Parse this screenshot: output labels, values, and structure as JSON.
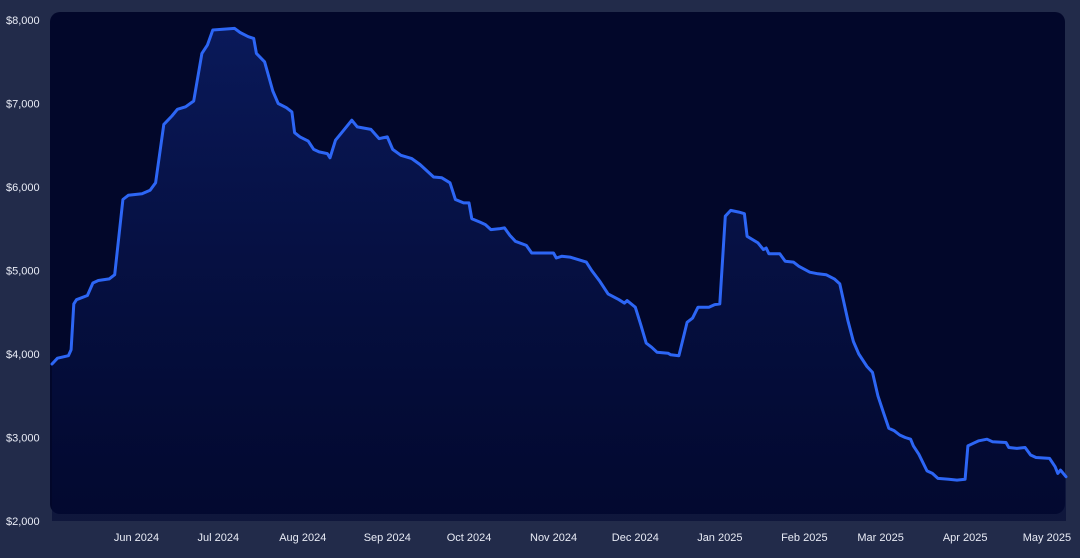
{
  "chart_data": {
    "type": "area",
    "title": "",
    "xlabel": "",
    "ylabel": "",
    "ylim": [
      2000,
      8000
    ],
    "xlim": [
      "2024-05-01",
      "2025-05-08"
    ],
    "grid": false,
    "legend": "none",
    "y_ticks": [
      {
        "value": 2000,
        "label": "$2,000"
      },
      {
        "value": 3000,
        "label": "$3,000"
      },
      {
        "value": 4000,
        "label": "$4,000"
      },
      {
        "value": 5000,
        "label": "$5,000"
      },
      {
        "value": 6000,
        "label": "$6,000"
      },
      {
        "value": 7000,
        "label": "$7,000"
      },
      {
        "value": 8000,
        "label": "$8,000"
      }
    ],
    "x_ticks": [
      {
        "date": "2024-06-01",
        "label": "Jun 2024"
      },
      {
        "date": "2024-07-01",
        "label": "Jul 2024"
      },
      {
        "date": "2024-08-01",
        "label": "Aug 2024"
      },
      {
        "date": "2024-09-01",
        "label": "Sep 2024"
      },
      {
        "date": "2024-10-01",
        "label": "Oct 2024"
      },
      {
        "date": "2024-11-01",
        "label": "Nov 2024"
      },
      {
        "date": "2024-12-01",
        "label": "Dec 2024"
      },
      {
        "date": "2025-01-01",
        "label": "Jan 2025"
      },
      {
        "date": "2025-02-01",
        "label": "Feb 2025"
      },
      {
        "date": "2025-03-01",
        "label": "Mar 2025"
      },
      {
        "date": "2025-04-01",
        "label": "Apr 2025"
      },
      {
        "date": "2025-05-01",
        "label": "May 2025"
      }
    ],
    "series": [
      {
        "points": [
          [
            "2024-05-01",
            3880
          ],
          [
            "2024-05-03",
            3950
          ],
          [
            "2024-05-07",
            3980
          ],
          [
            "2024-05-08",
            4050
          ],
          [
            "2024-05-09",
            4600
          ],
          [
            "2024-05-10",
            4650
          ],
          [
            "2024-05-14",
            4700
          ],
          [
            "2024-05-16",
            4850
          ],
          [
            "2024-05-18",
            4880
          ],
          [
            "2024-05-22",
            4900
          ],
          [
            "2024-05-24",
            4950
          ],
          [
            "2024-05-27",
            5850
          ],
          [
            "2024-05-29",
            5900
          ],
          [
            "2024-06-03",
            5920
          ],
          [
            "2024-06-06",
            5960
          ],
          [
            "2024-06-08",
            6050
          ],
          [
            "2024-06-11",
            6750
          ],
          [
            "2024-06-14",
            6850
          ],
          [
            "2024-06-16",
            6930
          ],
          [
            "2024-06-19",
            6960
          ],
          [
            "2024-06-22",
            7030
          ],
          [
            "2024-06-25",
            7600
          ],
          [
            "2024-06-27",
            7700
          ],
          [
            "2024-06-29",
            7880
          ],
          [
            "2024-07-07",
            7900
          ],
          [
            "2024-07-09",
            7850
          ],
          [
            "2024-07-12",
            7800
          ],
          [
            "2024-07-14",
            7780
          ],
          [
            "2024-07-15",
            7600
          ],
          [
            "2024-07-18",
            7500
          ],
          [
            "2024-07-21",
            7150
          ],
          [
            "2024-07-23",
            7000
          ],
          [
            "2024-07-26",
            6950
          ],
          [
            "2024-07-28",
            6900
          ],
          [
            "2024-07-29",
            6650
          ],
          [
            "2024-07-31",
            6600
          ],
          [
            "2024-08-03",
            6550
          ],
          [
            "2024-08-05",
            6450
          ],
          [
            "2024-08-07",
            6420
          ],
          [
            "2024-08-10",
            6400
          ],
          [
            "2024-08-11",
            6350
          ],
          [
            "2024-08-13",
            6560
          ],
          [
            "2024-08-16",
            6680
          ],
          [
            "2024-08-19",
            6800
          ],
          [
            "2024-08-21",
            6720
          ],
          [
            "2024-08-26",
            6690
          ],
          [
            "2024-08-29",
            6580
          ],
          [
            "2024-09-01",
            6600
          ],
          [
            "2024-09-03",
            6450
          ],
          [
            "2024-09-06",
            6380
          ],
          [
            "2024-09-10",
            6340
          ],
          [
            "2024-09-13",
            6270
          ],
          [
            "2024-09-18",
            6120
          ],
          [
            "2024-09-21",
            6110
          ],
          [
            "2024-09-24",
            6050
          ],
          [
            "2024-09-26",
            5850
          ],
          [
            "2024-09-29",
            5810
          ],
          [
            "2024-10-01",
            5810
          ],
          [
            "2024-10-02",
            5620
          ],
          [
            "2024-10-05",
            5580
          ],
          [
            "2024-10-07",
            5550
          ],
          [
            "2024-10-09",
            5490
          ],
          [
            "2024-10-12",
            5500
          ],
          [
            "2024-10-14",
            5510
          ],
          [
            "2024-10-16",
            5420
          ],
          [
            "2024-10-18",
            5350
          ],
          [
            "2024-10-22",
            5300
          ],
          [
            "2024-10-24",
            5210
          ],
          [
            "2024-11-01",
            5210
          ],
          [
            "2024-11-02",
            5150
          ],
          [
            "2024-11-04",
            5170
          ],
          [
            "2024-11-07",
            5160
          ],
          [
            "2024-11-10",
            5130
          ],
          [
            "2024-11-13",
            5100
          ],
          [
            "2024-11-15",
            5000
          ],
          [
            "2024-11-18",
            4870
          ],
          [
            "2024-11-21",
            4720
          ],
          [
            "2024-11-25",
            4650
          ],
          [
            "2024-11-27",
            4610
          ],
          [
            "2024-11-28",
            4640
          ],
          [
            "2024-12-01",
            4560
          ],
          [
            "2024-12-03",
            4350
          ],
          [
            "2024-12-05",
            4130
          ],
          [
            "2024-12-07",
            4080
          ],
          [
            "2024-12-09",
            4020
          ],
          [
            "2024-12-13",
            4010
          ],
          [
            "2024-12-14",
            3990
          ],
          [
            "2024-12-17",
            3980
          ],
          [
            "2024-12-20",
            4380
          ],
          [
            "2024-12-22",
            4430
          ],
          [
            "2024-12-24",
            4560
          ],
          [
            "2024-12-28",
            4560
          ],
          [
            "2024-12-30",
            4590
          ],
          [
            "2025-01-01",
            4600
          ],
          [
            "2025-01-03",
            5650
          ],
          [
            "2025-01-05",
            5720
          ],
          [
            "2025-01-08",
            5700
          ],
          [
            "2025-01-10",
            5680
          ],
          [
            "2025-01-11",
            5410
          ],
          [
            "2025-01-15",
            5330
          ],
          [
            "2025-01-17",
            5250
          ],
          [
            "2025-01-18",
            5270
          ],
          [
            "2025-01-19",
            5200
          ],
          [
            "2025-01-23",
            5200
          ],
          [
            "2025-01-25",
            5110
          ],
          [
            "2025-01-28",
            5100
          ],
          [
            "2025-01-30",
            5050
          ],
          [
            "2025-02-03",
            4980
          ],
          [
            "2025-02-06",
            4960
          ],
          [
            "2025-02-09",
            4950
          ],
          [
            "2025-02-12",
            4900
          ],
          [
            "2025-02-14",
            4840
          ],
          [
            "2025-02-17",
            4400
          ],
          [
            "2025-02-19",
            4150
          ],
          [
            "2025-02-21",
            4000
          ],
          [
            "2025-02-24",
            3850
          ],
          [
            "2025-02-26",
            3780
          ],
          [
            "2025-02-28",
            3500
          ],
          [
            "2025-03-02",
            3300
          ],
          [
            "2025-03-04",
            3110
          ],
          [
            "2025-03-06",
            3080
          ],
          [
            "2025-03-08",
            3030
          ],
          [
            "2025-03-10",
            3000
          ],
          [
            "2025-03-12",
            2980
          ],
          [
            "2025-03-13",
            2900
          ],
          [
            "2025-03-15",
            2800
          ],
          [
            "2025-03-18",
            2600
          ],
          [
            "2025-03-20",
            2570
          ],
          [
            "2025-03-22",
            2510
          ],
          [
            "2025-03-26",
            2500
          ],
          [
            "2025-03-29",
            2490
          ],
          [
            "2025-04-01",
            2500
          ],
          [
            "2025-04-02",
            2900
          ],
          [
            "2025-04-04",
            2930
          ],
          [
            "2025-04-06",
            2960
          ],
          [
            "2025-04-09",
            2980
          ],
          [
            "2025-04-11",
            2950
          ],
          [
            "2025-04-16",
            2940
          ],
          [
            "2025-04-17",
            2880
          ],
          [
            "2025-04-20",
            2870
          ],
          [
            "2025-04-23",
            2880
          ],
          [
            "2025-04-25",
            2790
          ],
          [
            "2025-04-27",
            2760
          ],
          [
            "2025-05-02",
            2750
          ],
          [
            "2025-05-04",
            2650
          ],
          [
            "2025-05-05",
            2570
          ],
          [
            "2025-05-06",
            2610
          ],
          [
            "2025-05-08",
            2530
          ]
        ]
      }
    ]
  },
  "colors": {
    "page_background": "#222b4a",
    "plot_background": "#02072a",
    "line": "#2d66f5",
    "area_top": "#0a1a5c",
    "area_bottom": "#030a33",
    "tick_text": "#e8ebf5"
  }
}
